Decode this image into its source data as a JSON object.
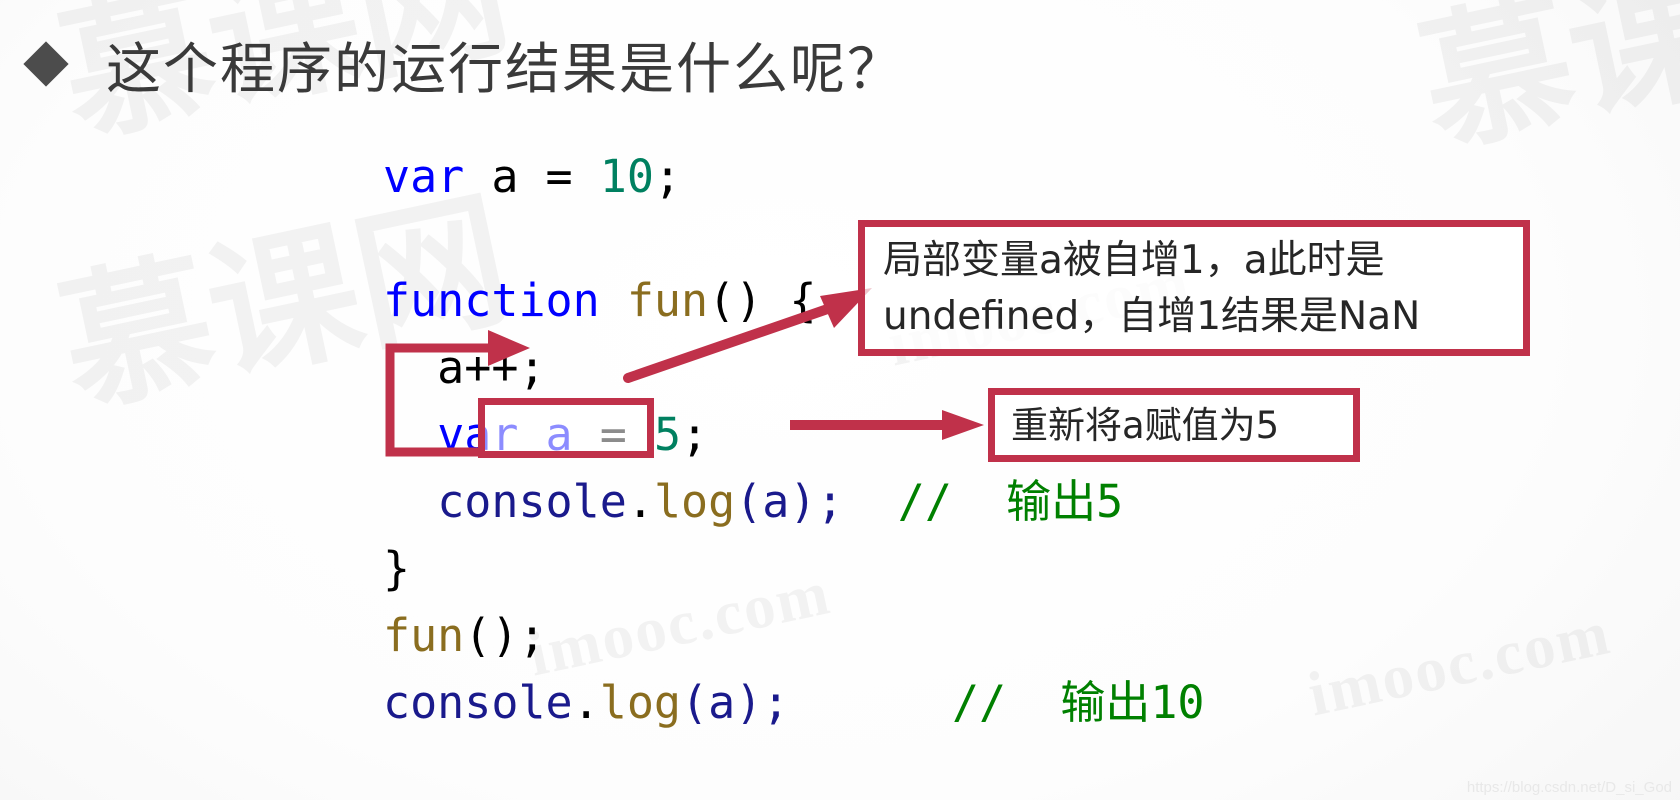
{
  "slide": {
    "title": "这个程序的运行结果是什么呢？",
    "bullet_icon": "diamond-bullet-icon"
  },
  "code": {
    "language": "javascript",
    "lines": [
      {
        "id": "line-1",
        "tokens": [
          {
            "text": "var",
            "cls": "kw"
          },
          {
            "text": " a = ",
            "cls": "punct"
          },
          {
            "text": "10",
            "cls": "num"
          },
          {
            "text": ";",
            "cls": "punct"
          }
        ]
      },
      {
        "id": "line-blank",
        "tokens": []
      },
      {
        "id": "line-2",
        "tokens": [
          {
            "text": "function",
            "cls": "kw"
          },
          {
            "text": " ",
            "cls": "punct"
          },
          {
            "text": "fun",
            "cls": "fn"
          },
          {
            "text": "() {",
            "cls": "punct"
          }
        ]
      },
      {
        "id": "line-3",
        "tokens": [
          {
            "text": "  a++;",
            "cls": "punct"
          }
        ]
      },
      {
        "id": "line-4",
        "tokens": [
          {
            "text": "  ",
            "cls": "punct"
          },
          {
            "text": "var a",
            "cls": "kw"
          },
          {
            "text": " = ",
            "cls": "punct"
          },
          {
            "text": "5",
            "cls": "num"
          },
          {
            "text": ";",
            "cls": "punct"
          }
        ]
      },
      {
        "id": "line-5",
        "tokens": [
          {
            "text": "  ",
            "cls": "punct"
          },
          {
            "text": "console",
            "cls": "obj"
          },
          {
            "text": ".",
            "cls": "punct"
          },
          {
            "text": "log",
            "cls": "fn"
          },
          {
            "text": "(a);",
            "cls": "obj"
          },
          {
            "text": "  ",
            "cls": "punct"
          },
          {
            "text": "//  输出5",
            "cls": "cmt"
          }
        ]
      },
      {
        "id": "line-6",
        "tokens": [
          {
            "text": "}",
            "cls": "punct"
          }
        ]
      },
      {
        "id": "line-7",
        "tokens": [
          {
            "text": "fun",
            "cls": "fn"
          },
          {
            "text": "();",
            "cls": "punct"
          }
        ]
      },
      {
        "id": "line-8",
        "tokens": [
          {
            "text": "console",
            "cls": "obj"
          },
          {
            "text": ".",
            "cls": "punct"
          },
          {
            "text": "log",
            "cls": "fn"
          },
          {
            "text": "(a);",
            "cls": "obj"
          },
          {
            "text": "      ",
            "cls": "punct"
          },
          {
            "text": "//  输出10",
            "cls": "cmt"
          }
        ]
      }
    ]
  },
  "annotations": {
    "highlight_label": "var a",
    "callout_1": {
      "line_1": "局部变量a被自增1，a此时是",
      "line_2": "undefined，自增1结果是NaN"
    },
    "callout_2": {
      "line_1": "重新将a赋值为5"
    }
  },
  "watermarks": {
    "brand_main": "慕课网",
    "brand_sub": "imooc.com",
    "source_url": "https://blog.csdn.net/D_si_God"
  },
  "colors": {
    "accent_red": "#c0314a",
    "keyword_blue": "#0000ff",
    "number_green": "#008060",
    "function_gold": "#8a6d1f",
    "object_navy": "#1a1a8c",
    "comment_green": "#008000",
    "title_gray": "#3a3a3a"
  }
}
